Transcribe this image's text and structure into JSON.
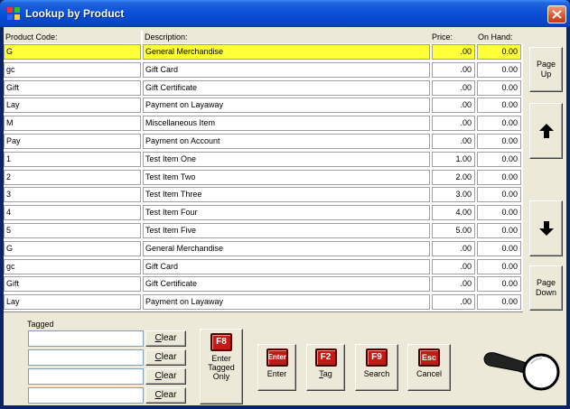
{
  "window": {
    "title": "Lookup by Product",
    "icon": "app-grid-icon",
    "close_icon": "close-icon"
  },
  "grid": {
    "headers": {
      "code": "Product Code:",
      "description": "Description:",
      "price": "Price:",
      "on_hand": "On Hand:"
    },
    "rows": [
      {
        "code": "G",
        "description": "General Merchandise",
        "price": ".00",
        "on_hand": "0.00",
        "selected": true
      },
      {
        "code": "gc",
        "description": "Gift Card",
        "price": ".00",
        "on_hand": "0.00"
      },
      {
        "code": "Gift",
        "description": "Gift Certificate",
        "price": ".00",
        "on_hand": "0.00"
      },
      {
        "code": "Lay",
        "description": "Payment on Layaway",
        "price": ".00",
        "on_hand": "0.00"
      },
      {
        "code": "M",
        "description": "Miscellaneous Item",
        "price": ".00",
        "on_hand": "0.00"
      },
      {
        "code": "Pay",
        "description": "Payment on Account",
        "price": ".00",
        "on_hand": "0.00"
      },
      {
        "code": "1",
        "description": "Test Item One",
        "price": "1.00",
        "on_hand": "0.00"
      },
      {
        "code": "2",
        "description": "Test Item Two",
        "price": "2.00",
        "on_hand": "0.00"
      },
      {
        "code": "3",
        "description": "Test Item Three",
        "price": "3.00",
        "on_hand": "0.00"
      },
      {
        "code": "4",
        "description": "Test Item Four",
        "price": "4.00",
        "on_hand": "0.00"
      },
      {
        "code": "5",
        "description": "Test Item Five",
        "price": "5.00",
        "on_hand": "0.00"
      },
      {
        "code": "G",
        "description": "General Merchandise",
        "price": ".00",
        "on_hand": "0.00"
      },
      {
        "code": "gc",
        "description": "Gift Card",
        "price": ".00",
        "on_hand": "0.00"
      },
      {
        "code": "Gift",
        "description": "Gift Certificate",
        "price": ".00",
        "on_hand": "0.00"
      },
      {
        "code": "Lay",
        "description": "Payment on Layaway",
        "price": ".00",
        "on_hand": "0.00"
      }
    ],
    "selected_color": "#ffff3a"
  },
  "nav": {
    "page_up_line1": "Page",
    "page_up_line2": "Up",
    "page_down_line1": "Page",
    "page_down_line2": "Down",
    "up_icon": "arrow-up-icon",
    "down_icon": "arrow-down-icon"
  },
  "tagged": {
    "label": "Tagged",
    "inputs": [
      "",
      "",
      "",
      ""
    ],
    "clear_first": "C",
    "clear_rest": "lear"
  },
  "buttons": {
    "enter_tagged": {
      "key": "F8",
      "line1": "Enter",
      "line2": "Tagged",
      "line3": "Only"
    },
    "enter": {
      "key": "Enter",
      "label": "Enter"
    },
    "tag": {
      "key": "F2",
      "label_first": "T",
      "label_rest": "ag"
    },
    "search": {
      "key": "F9",
      "label": "Search"
    },
    "cancel": {
      "key": "Esc",
      "label": "Cancel"
    },
    "key_color": "#c41a14"
  },
  "decor": {
    "magnifier_icon": "magnifying-glass-icon"
  }
}
